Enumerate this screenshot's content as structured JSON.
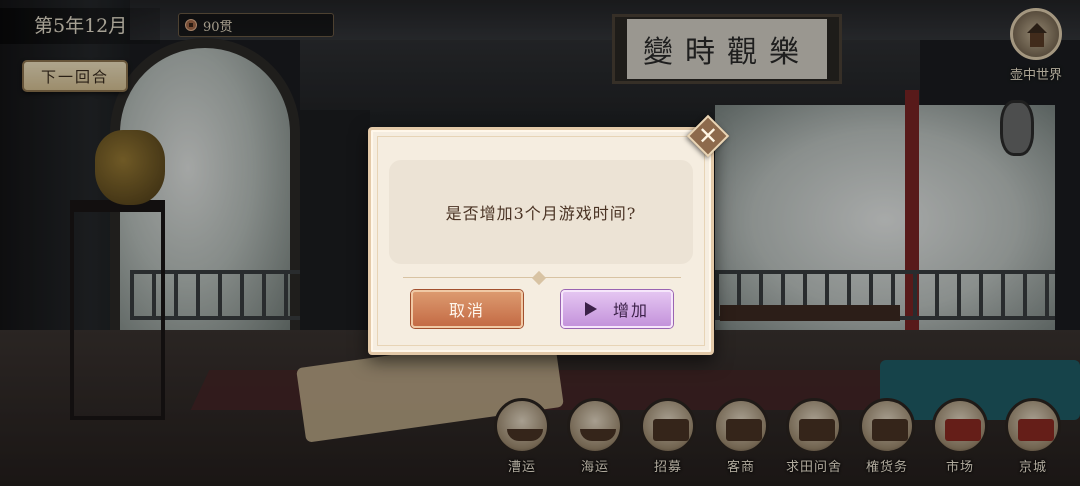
{
  "hud": {
    "date": "第5年12月",
    "money": "90贯",
    "next_turn_label": "下一回合",
    "world_label": "壶中世界"
  },
  "scene": {
    "plaque_text": "變時觀樂"
  },
  "dialog": {
    "message": "是否增加3个月游戏时间?",
    "cancel_label": "取消",
    "add_label": "增加",
    "close_icon": "close-icon"
  },
  "bottom_menu": {
    "items": [
      {
        "label": "漕运",
        "icon": "boat-icon"
      },
      {
        "label": "海运",
        "icon": "ship-icon"
      },
      {
        "label": "招募",
        "icon": "recruit-icon"
      },
      {
        "label": "客商",
        "icon": "cart-icon"
      },
      {
        "label": "求田问舍",
        "icon": "field-icon"
      },
      {
        "label": "榷货务",
        "icon": "warehouse-icon"
      },
      {
        "label": "市场",
        "icon": "market-icon"
      },
      {
        "label": "京城",
        "icon": "capital-icon"
      }
    ]
  },
  "colors": {
    "dialog_bg": "#f5ede0",
    "cancel": "#c46b45",
    "add": "#c493db",
    "text_dark": "#4a3324"
  }
}
